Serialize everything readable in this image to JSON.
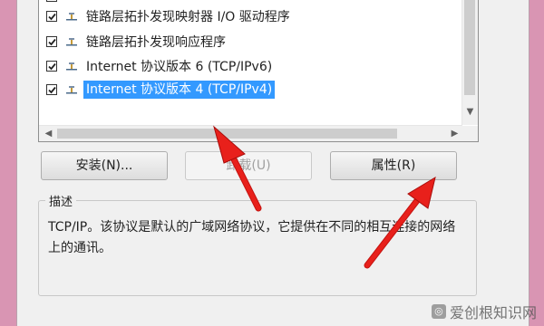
{
  "list": {
    "items": [
      {
        "label": "链路层拓扑发现映射器 I/O 驱动程序",
        "checked": true,
        "selected": false
      },
      {
        "label": "链路层拓扑发现响应程序",
        "checked": true,
        "selected": false
      },
      {
        "label": "Internet 协议版本 6 (TCP/IPv6)",
        "checked": true,
        "selected": false
      },
      {
        "label": "Internet 协议版本 4 (TCP/IPv4)",
        "checked": true,
        "selected": true
      }
    ]
  },
  "buttons": {
    "install": "安装(N)...",
    "uninstall": "卸载(U)",
    "properties": "属性(R)"
  },
  "description": {
    "title": "描述",
    "text": "TCP/IP。该协议是默认的广域网络协议，它提供在不同的相互连接的网络上的通讯。"
  },
  "scroll_arrows": {
    "up": "▲",
    "down": "▼",
    "left": "◀",
    "right": "▶"
  },
  "watermark": {
    "text": "爱创根知识网",
    "logo": "◎"
  },
  "colors": {
    "selection": "#3399ff",
    "annotation_arrow": "#e8201b",
    "background": "#d995b3"
  }
}
